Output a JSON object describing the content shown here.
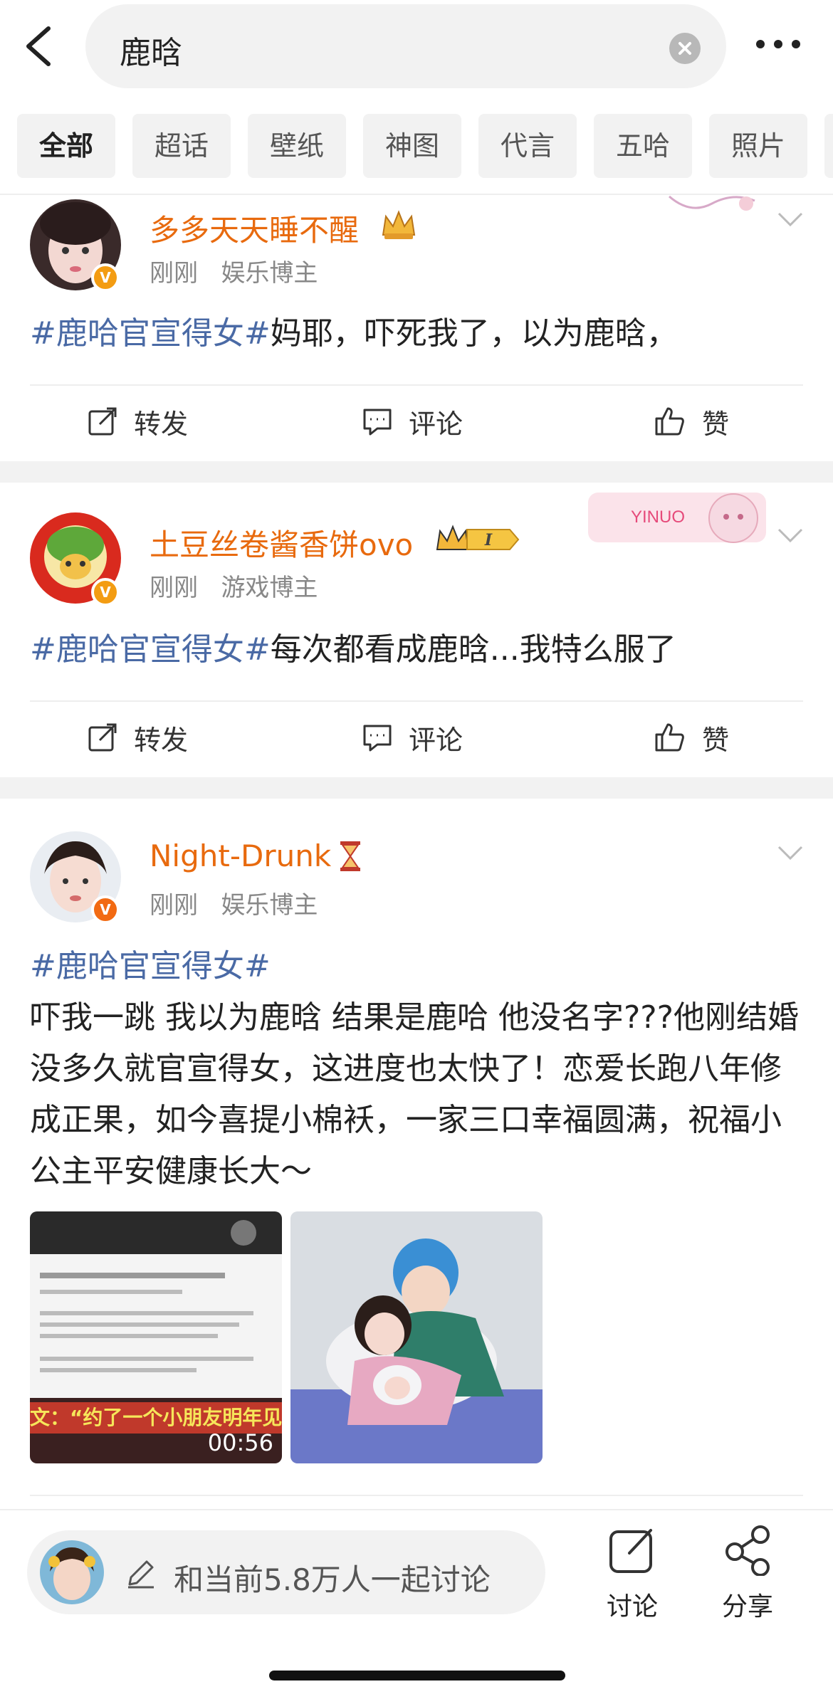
{
  "header": {
    "search_query": "鹿晗"
  },
  "tabs": [
    "全部",
    "超话",
    "壁纸",
    "神图",
    "代言",
    "五哈",
    "照片"
  ],
  "posts": [
    {
      "username": "多多天天睡不醒",
      "time": "刚刚",
      "category": "娱乐博主",
      "hashtag": "#鹿哈官宣得女#",
      "text": "妈耶，吓死我了，以为鹿晗，"
    },
    {
      "username": "土豆丝卷酱香饼ovo",
      "time": "刚刚",
      "category": "游戏博主",
      "hashtag": "#鹿哈官宣得女#",
      "text": "每次都看成鹿晗...我特么服了",
      "card_label": "YINUO"
    },
    {
      "username": "Night-Drunk",
      "time": "刚刚",
      "category": "娱乐博主",
      "hashtag": "#鹿哈官宣得女#",
      "text": "吓我一跳  我以为鹿晗   结果是鹿哈  他没名字???他刚结婚没多久就官宣得女，这进度也太快了！恋爱长跑八年修成正果，如今喜提小棉袄，一家三口幸福圆满，祝福小公主平安健康长大～",
      "video_caption": "文：“约了一个小朋友明年见呀",
      "video_duration": "00:56"
    }
  ],
  "actions": {
    "repost": "转发",
    "comment": "评论",
    "like": "赞"
  },
  "bottom_bar": {
    "discuss_placeholder": "和当前5.8万人一起讨论",
    "discuss_label": "讨论",
    "share_label": "分享"
  },
  "colors": {
    "username": "#e86a0e",
    "hashtag": "#4a6aa5",
    "verified_badge": "#f39c12"
  }
}
